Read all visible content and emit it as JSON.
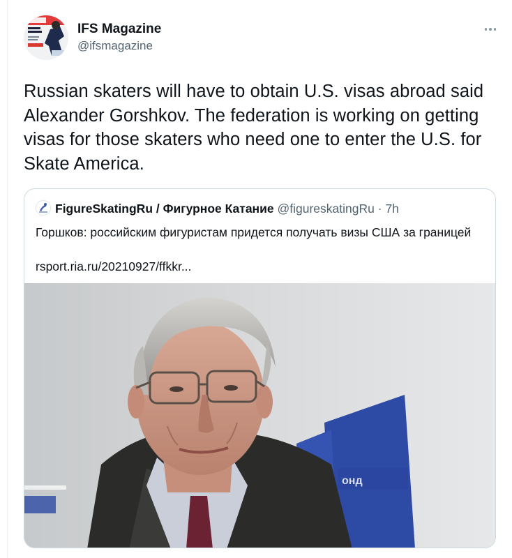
{
  "tweet": {
    "author": {
      "display_name": "IFS Magazine",
      "handle": "@ifsmagazine",
      "avatar_icon": "magazine-cover-avatar"
    },
    "more_icon": "more-horizontal-icon",
    "text": "Russian skaters will have to obtain U.S. visas abroad said Alexander Gorshkov. The federation is working on getting visas for those skaters who need one to enter the U.S. for Skate America."
  },
  "quote": {
    "author_name": "FigureSkatingRu / Фигурное Катание",
    "author_handle": "@figureskatingRu",
    "separator": "·",
    "time": "7h",
    "avatar_icon": "skater-logo-avatar",
    "text": "Горшков: российским фигуристам придется получать визы США за границей",
    "link": "rsport.ria.ru/20210927/ffkkr...",
    "media_description": "photo-of-man-in-glasses"
  },
  "colors": {
    "text_primary": "#0f1419",
    "text_secondary": "#536471",
    "border": "#cfd9de"
  }
}
